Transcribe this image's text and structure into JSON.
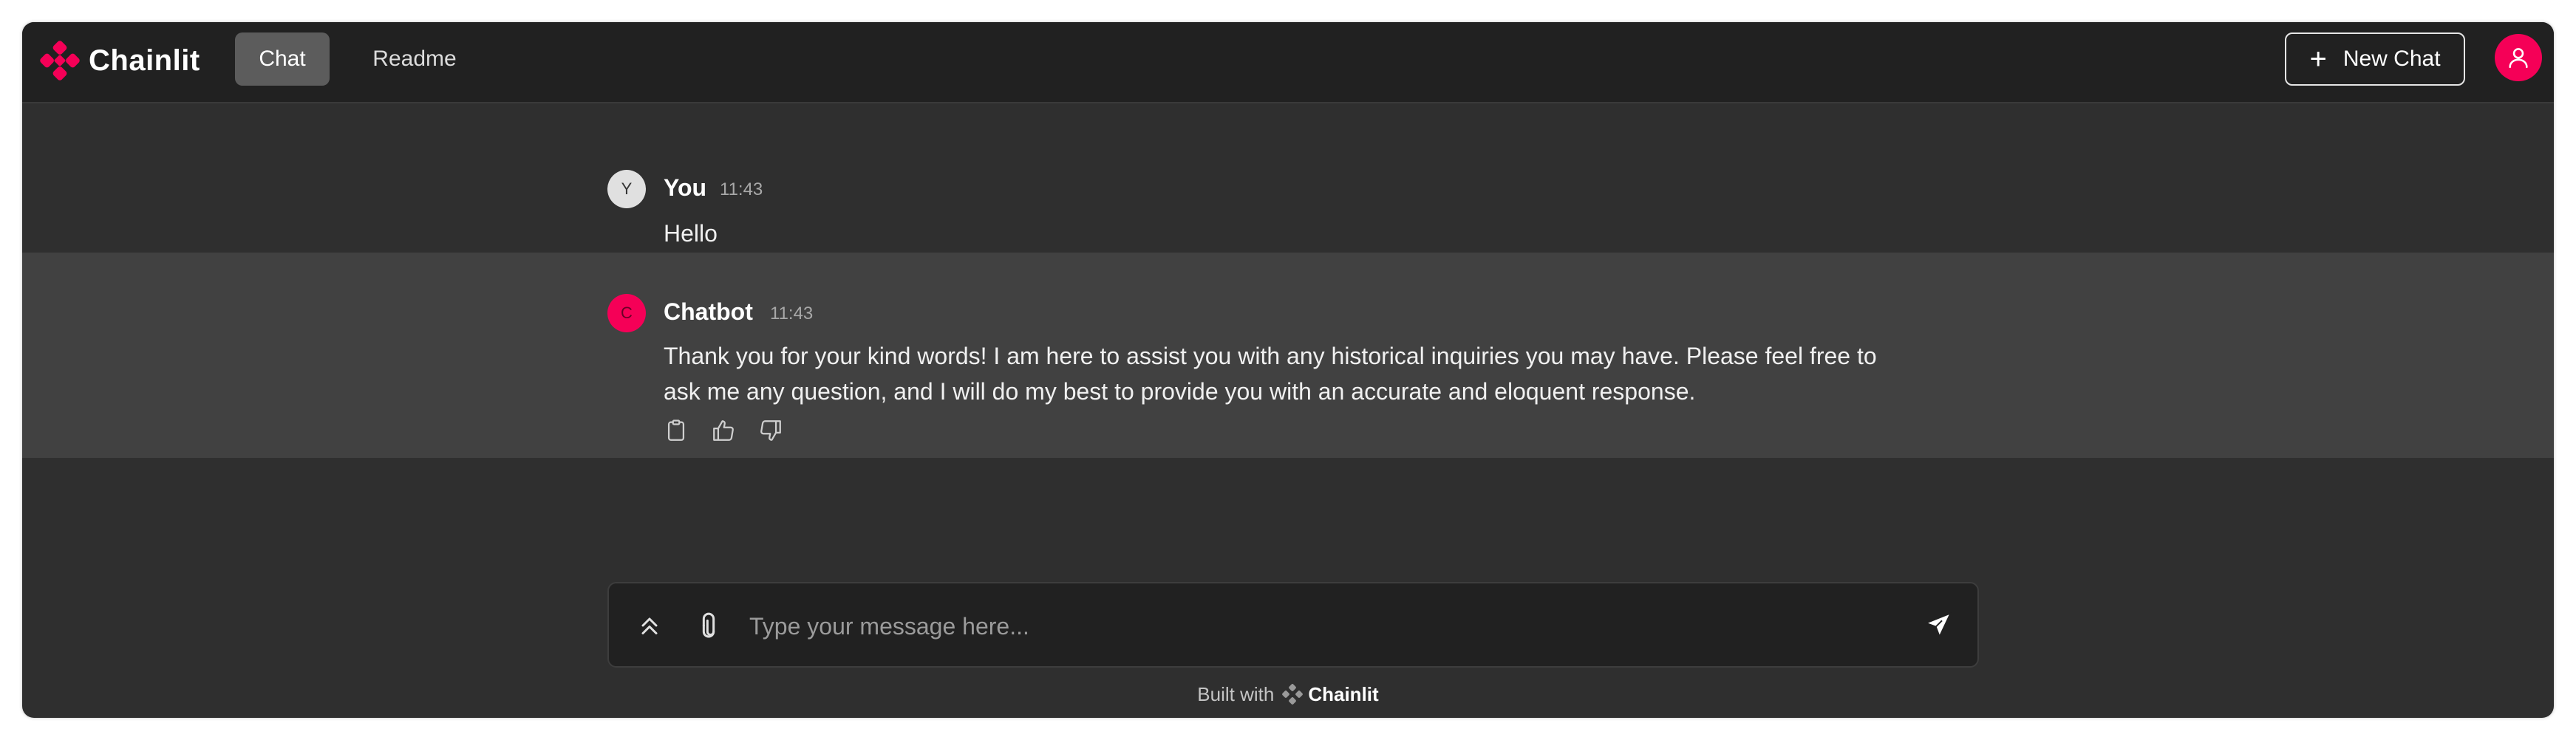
{
  "app": {
    "name": "Chainlit"
  },
  "header": {
    "tabs": [
      {
        "label": "Chat",
        "active": true
      },
      {
        "label": "Readme",
        "active": false
      }
    ],
    "new_chat_label": "New Chat"
  },
  "messages": [
    {
      "avatar_letter": "Y",
      "author": "You",
      "time": "11:43",
      "lines": [
        "Hello"
      ]
    },
    {
      "avatar_letter": "C",
      "author": "Chatbot",
      "time": "11:43",
      "lines": [
        "Thank you for your kind words! I am here to assist you with any historical inquiries you may have. Please feel free to",
        "ask me any question, and I will do my best to provide you with an accurate and eloquent response."
      ],
      "actions": [
        "clipboard-icon",
        "thumbs-up-icon",
        "thumbs-down-icon"
      ]
    }
  ],
  "composer": {
    "placeholder": "Type your message here..."
  },
  "footer": {
    "built_with": "Built with",
    "brand": "Chainlit"
  },
  "colors": {
    "accent": "#f50057",
    "header_bg": "#212121",
    "page_bg": "#2f2f2f",
    "bot_row_bg": "#414141"
  }
}
